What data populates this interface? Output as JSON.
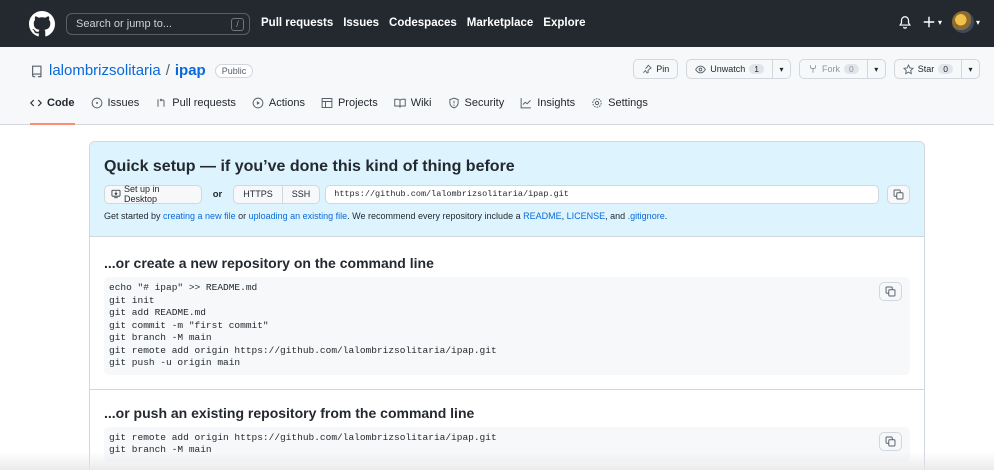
{
  "header": {
    "search_placeholder": "Search or jump to...",
    "slash_key": "/",
    "nav": [
      "Pull requests",
      "Issues",
      "Codespaces",
      "Marketplace",
      "Explore"
    ]
  },
  "repo": {
    "owner": "lalombrizsolitaria",
    "separator": "/",
    "name": "ipap",
    "visibility": "Public",
    "pin_label": "Pin",
    "unwatch_label": "Unwatch",
    "watch_count": "1",
    "fork_label": "Fork",
    "fork_count": "0",
    "star_label": "Star",
    "star_count": "0"
  },
  "tabs": [
    {
      "label": "Code",
      "icon": "code-icon"
    },
    {
      "label": "Issues",
      "icon": "issue-icon"
    },
    {
      "label": "Pull requests",
      "icon": "pull-request-icon"
    },
    {
      "label": "Actions",
      "icon": "play-icon"
    },
    {
      "label": "Projects",
      "icon": "table-icon"
    },
    {
      "label": "Wiki",
      "icon": "book-icon"
    },
    {
      "label": "Security",
      "icon": "shield-icon"
    },
    {
      "label": "Insights",
      "icon": "graph-icon"
    },
    {
      "label": "Settings",
      "icon": "gear-icon"
    }
  ],
  "quick_setup": {
    "title": "Quick setup — if you’ve done this kind of thing before",
    "desktop_button": "Set up in Desktop",
    "or_text": "or",
    "https_label": "HTTPS",
    "ssh_label": "SSH",
    "clone_url": "https://github.com/lalombrizsolitaria/ipap.git",
    "hint_prefix": "Get started by ",
    "hint_link1": "creating a new file",
    "hint_mid1": " or ",
    "hint_link2": "uploading an existing file",
    "hint_mid2": ". We recommend every repository include a ",
    "hint_link3": "README",
    "hint_comma1": ", ",
    "hint_link4": "LICENSE",
    "hint_mid3": ", and ",
    "hint_link5": ".gitignore",
    "hint_end": "."
  },
  "new_repo": {
    "title": "...or create a new repository on the command line",
    "lines": [
      "echo \"# ipap\" >> README.md",
      "git init",
      "git add README.md",
      "git commit -m \"first commit\"",
      "git branch -M main",
      "git remote add origin https://github.com/lalombrizsolitaria/ipap.git",
      "git push -u origin main"
    ]
  },
  "push_existing": {
    "title": "...or push an existing repository from the command line",
    "lines": [
      "git remote add origin https://github.com/lalombrizsolitaria/ipap.git",
      "git branch -M main"
    ]
  }
}
